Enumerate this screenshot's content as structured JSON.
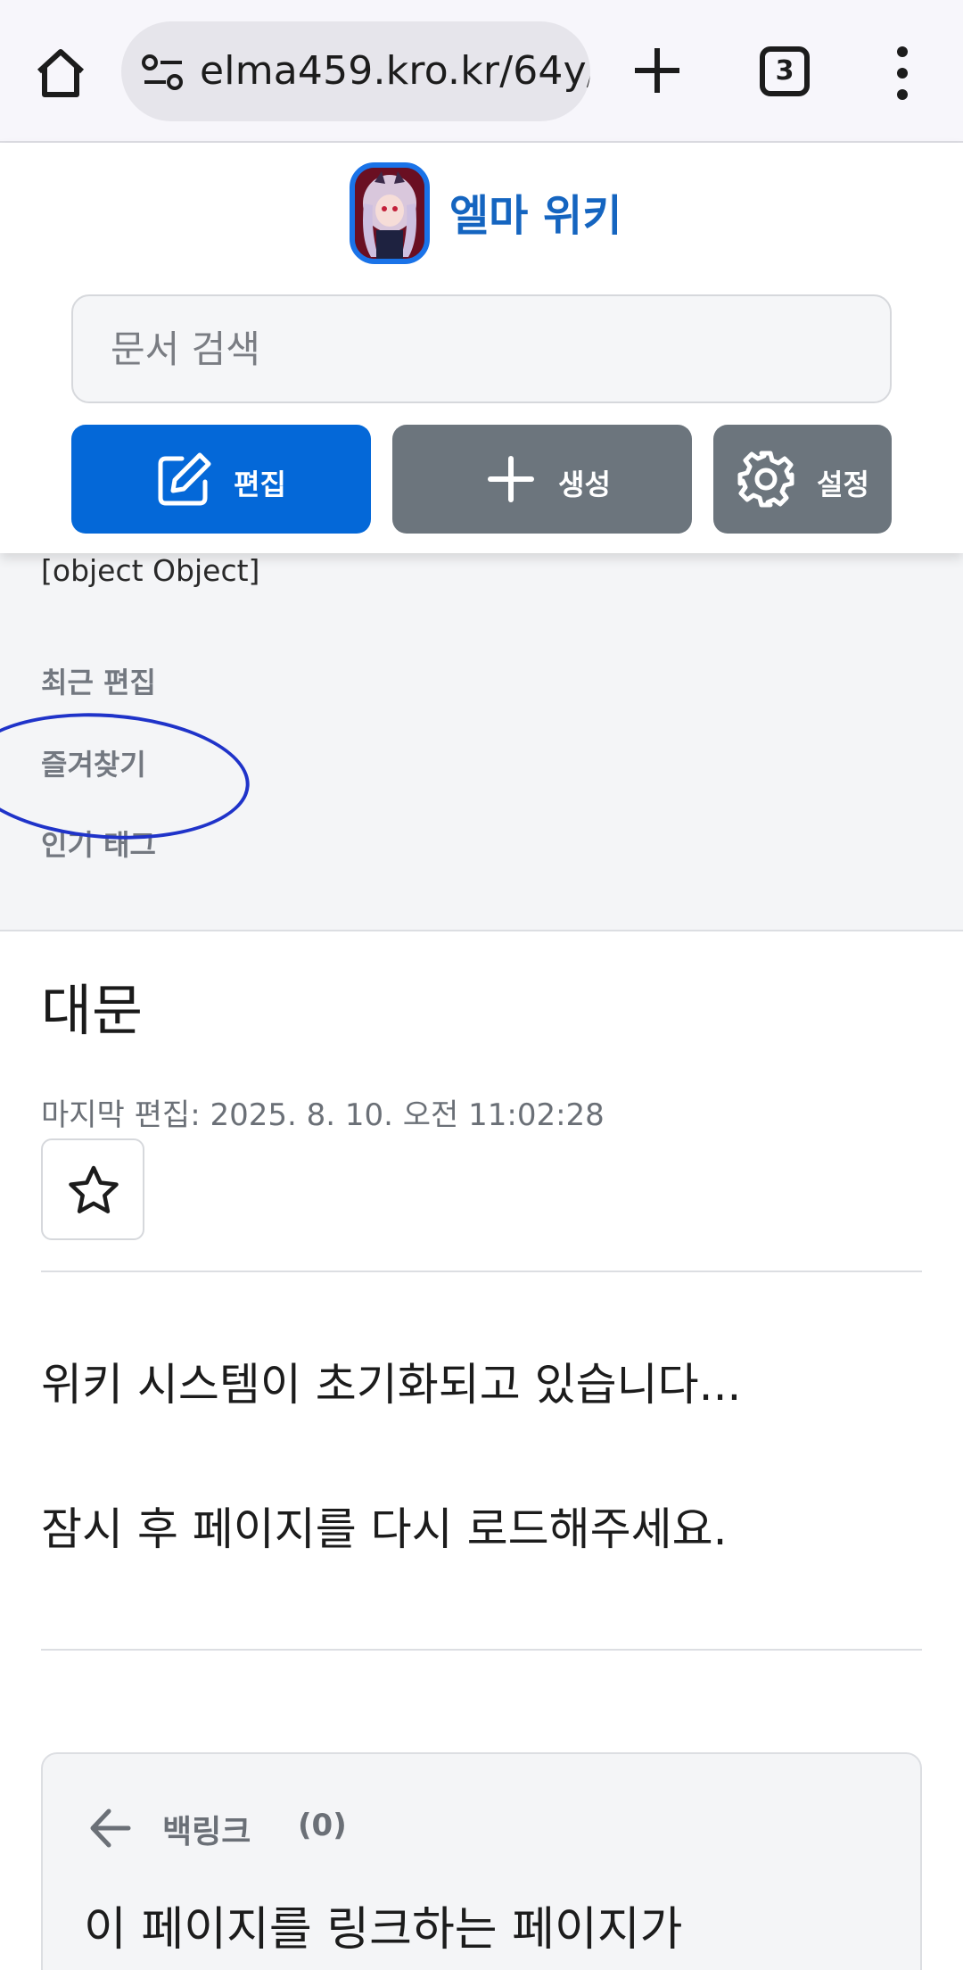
{
  "browser": {
    "url": "elma459.kro.kr/64y/",
    "tab_count": "3"
  },
  "header": {
    "site_title": "엘마 위키",
    "search_placeholder": "문서 검색",
    "edit_label": "편집",
    "create_label": "생성",
    "settings_label": "설정",
    "accent_color": "#0468d8",
    "secondary_color": "#6c757d"
  },
  "sidebar": {
    "object_text": "[object Object]",
    "links": [
      "최근 편집",
      "즐겨찾기",
      "인기 태그"
    ]
  },
  "annotation": {
    "color": "#1f33c9"
  },
  "main": {
    "title": "대문",
    "last_edited": "마지막 편집: 2025. 8. 10. 오전 11:02:28",
    "paragraphs": [
      "위키 시스템이 초기화되고 있습니다...",
      "잠시 후 페이지를 다시 로드해주세요."
    ]
  },
  "backlinks": {
    "title": "백링크",
    "count": "(0)",
    "description": "이 페이지를 링크하는 페이지가"
  }
}
